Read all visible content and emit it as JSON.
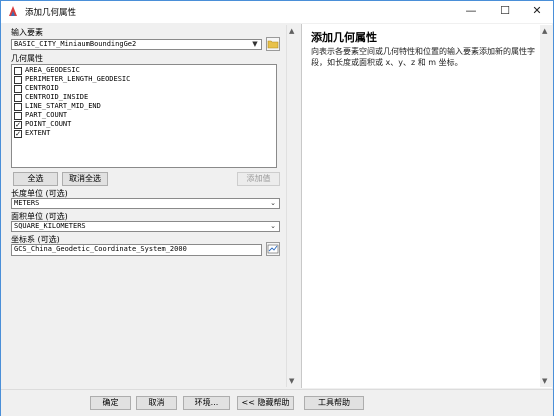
{
  "window": {
    "title": "添加几何属性",
    "minimize": "—",
    "maximize": "☐",
    "close": "✕"
  },
  "input_features": {
    "label": "输入要素",
    "value": "BASIC_CITY_MiniaumBoundingGe2"
  },
  "geometry": {
    "label": "几何属性",
    "items": [
      {
        "label": "AREA_GEODESIC",
        "checked": false
      },
      {
        "label": "PERIMETER_LENGTH_GEODESIC",
        "checked": false
      },
      {
        "label": "CENTROID",
        "checked": false
      },
      {
        "label": "CENTROID_INSIDE",
        "checked": false
      },
      {
        "label": "LINE_START_MID_END",
        "checked": false
      },
      {
        "label": "PART_COUNT",
        "checked": false
      },
      {
        "label": "POINT_COUNT",
        "checked": true
      },
      {
        "label": "EXTENT",
        "checked": true
      }
    ],
    "select_all": "全选",
    "clear_all": "取消全选",
    "add_value": "添加值"
  },
  "length_unit": {
    "label": "长度单位 (可选)",
    "value": "METERS"
  },
  "area_unit": {
    "label": "面积单位 (可选)",
    "value": "SQUARE_KILOMETERS"
  },
  "coord_system": {
    "label": "坐标系 (可选)",
    "value": "GCS_China_Geodetic_Coordinate_System_2000"
  },
  "help": {
    "title": "添加几何属性",
    "body": "向表示各要素空间或几何特性和位置的输入要素添加新的属性字段，如长度或面积或 x、y、z 和 m 坐标。"
  },
  "buttons": {
    "ok": "确定",
    "cancel": "取消",
    "env": "环境...",
    "hide_help": "<< 隐藏帮助",
    "tool_help": "工具帮助"
  },
  "colors": {
    "title_bar": "#ffffff",
    "border": "#4a8fd8",
    "panel": "#f0f0f0"
  }
}
